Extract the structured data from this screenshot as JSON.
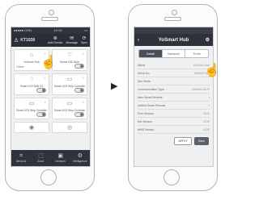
{
  "left_phone": {
    "status_bar": {
      "carrier": "●●●●● CHN",
      "time": "10:10",
      "battery": "▭"
    },
    "header": {
      "title": "KT1028",
      "actions": [
        {
          "label": "Add Device",
          "icon": "plus-icon",
          "glyph": "⊕"
        },
        {
          "label": "Message",
          "icon": "mail-icon",
          "glyph": "✉"
        },
        {
          "label": "Sync",
          "icon": "refresh-icon",
          "glyph": "⟳"
        }
      ]
    },
    "devices": [
      {
        "name": "YoSmart Hub",
        "status": "Online",
        "icon": "hub-icon",
        "glyph": "⌂",
        "has_toggle": false
      },
      {
        "name": "Smart LED Bulb",
        "status": "",
        "icon": "bulb-icon",
        "glyph": "♡",
        "has_toggle": true
      },
      {
        "name": "Smart LED Bulb S1",
        "status": "",
        "icon": "bulb-icon",
        "glyph": "♢",
        "has_toggle": true
      },
      {
        "name": "Smart LED Strip Controller",
        "status": "",
        "icon": "strip-icon",
        "glyph": "▭",
        "has_toggle": true
      },
      {
        "name": "Smart LED Strip Controller",
        "status": "",
        "icon": "strip-icon",
        "glyph": "▭",
        "has_toggle": true
      },
      {
        "name": "Smart LED Strip Controller",
        "status": "",
        "icon": "strip-icon",
        "glyph": "▭",
        "has_toggle": true
      },
      {
        "name": "",
        "status": "",
        "icon": "plug-icon",
        "glyph": "◉",
        "has_toggle": false
      },
      {
        "name": "",
        "status": "",
        "icon": "sensor-icon",
        "glyph": "◎",
        "has_toggle": false
      }
    ],
    "tabbar": [
      {
        "label": "Devices",
        "icon": "devices-icon",
        "glyph": "⌗"
      },
      {
        "label": "Zone",
        "icon": "zone-icon",
        "glyph": "⬚"
      },
      {
        "label": "Devices",
        "icon": "devices2-icon",
        "glyph": "▣"
      },
      {
        "label": "Intelligence",
        "icon": "intelligence-icon",
        "glyph": "⚙"
      }
    ]
  },
  "arrow": "▶",
  "right_phone": {
    "header": {
      "title": "YoSmart Hub",
      "back": "‹",
      "settings": "⚙"
    },
    "tabs": [
      "Detail",
      "Network",
      "Timer"
    ],
    "rows": [
      {
        "label": "Name",
        "value": "YoSmart Hub"
      },
      {
        "label": "Serial No.",
        "value": "D88A0F24C"
      },
      {
        "label": "Dev Mode",
        "value": ""
      },
      {
        "label": "Communication Type",
        "value": "433MHz/Wi-Fi"
      },
      {
        "label": "New Smart Remote",
        "value": "›"
      },
      {
        "label": "Unified Smart Remote",
        "value": "›"
      },
      {
        "label": "Firm Version",
        "value": "0030"
      },
      {
        "label": "Set Version",
        "value": "0030"
      },
      {
        "label": "MHB Version",
        "value": "0030"
      }
    ],
    "buttons": {
      "primary": "Save",
      "secondary": "APPLY"
    }
  }
}
